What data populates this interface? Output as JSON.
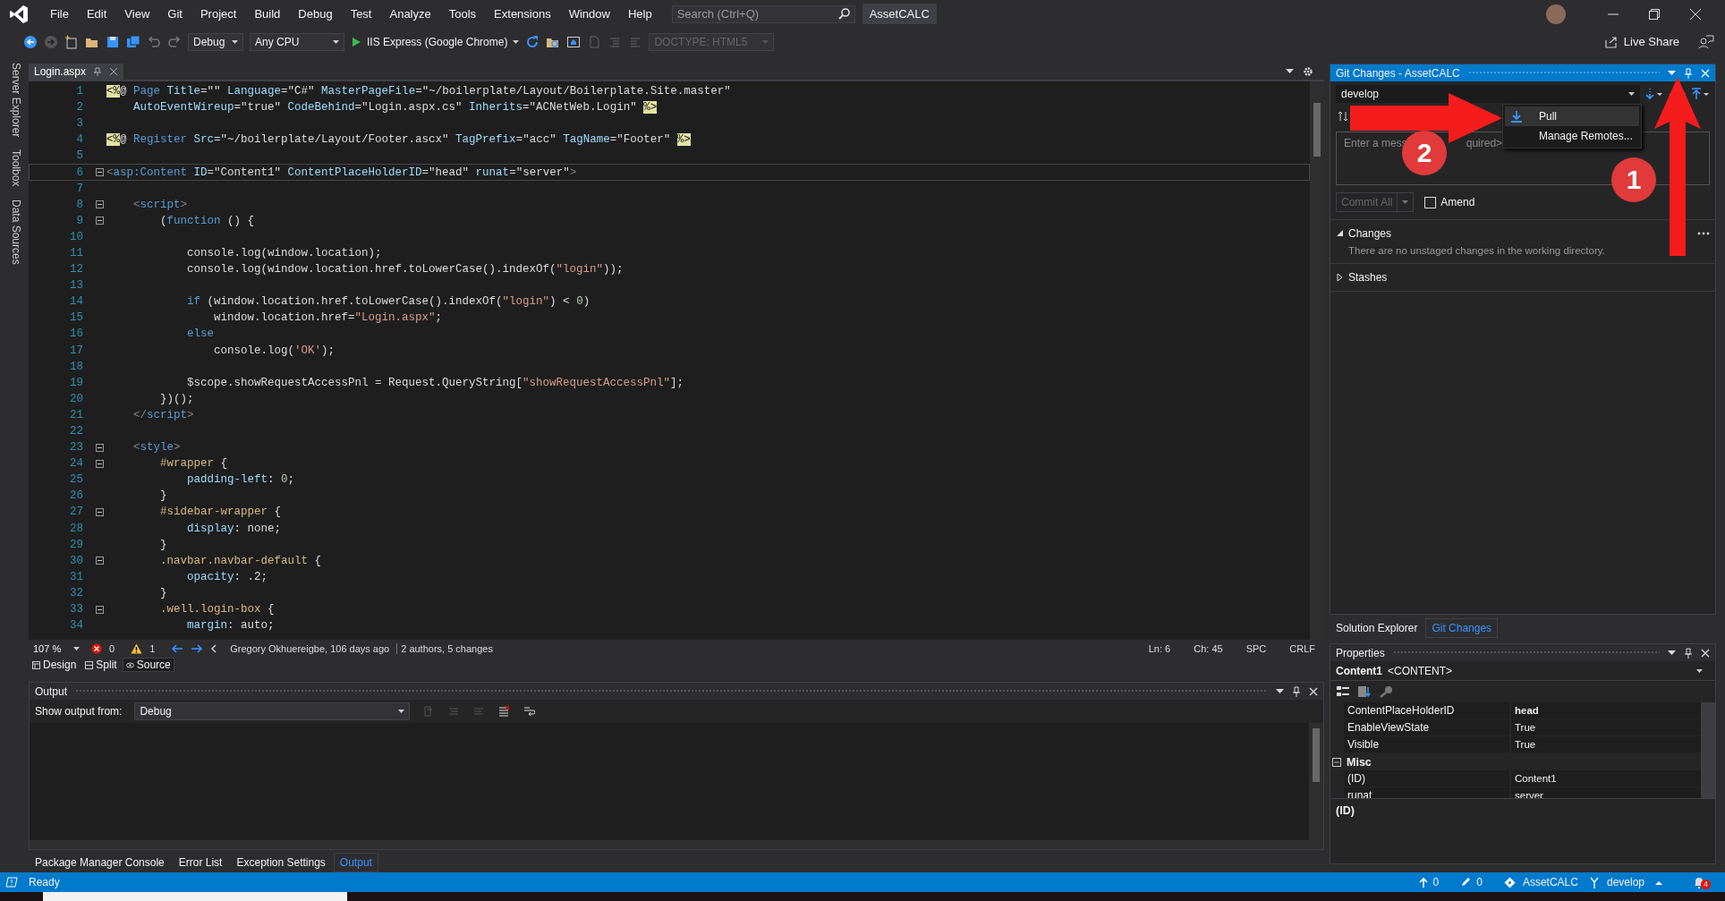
{
  "menu_bar": {
    "items": [
      "File",
      "Edit",
      "View",
      "Git",
      "Project",
      "Build",
      "Debug",
      "Test",
      "Analyze",
      "Tools",
      "Extensions",
      "Window",
      "Help"
    ],
    "search": {
      "placeholder": "Search (Ctrl+Q)"
    },
    "solution_name": "AssetCALC"
  },
  "toolbar": {
    "configuration": "Debug",
    "platform": "Any CPU",
    "run_target": "IIS Express (Google Chrome)",
    "doctype": {
      "value": "DOCTYPE: HTML5",
      "disabled": true
    },
    "live_share": "Live Share"
  },
  "side_tabs": [
    "Server Explorer",
    "Toolbox",
    "Data Sources"
  ],
  "editor": {
    "tabs": [
      {
        "label": "Login.aspx",
        "selected": true
      }
    ],
    "lines": [
      {
        "num": "1",
        "fold": false,
        "current": false,
        "tokens": [
          {
            "kind": "dir",
            "text": "<%"
          },
          {
            "kind": "plain",
            "text": "@ "
          },
          {
            "kind": "kw",
            "text": "Page "
          },
          {
            "kind": "attr",
            "text": "Title"
          },
          {
            "kind": "plain",
            "text": "=\"\" "
          },
          {
            "kind": "attr",
            "text": "Language"
          },
          {
            "kind": "plain",
            "text": "=\"C#\" "
          },
          {
            "kind": "attr",
            "text": "MasterPageFile"
          },
          {
            "kind": "plain",
            "text": "=\"~/boilerplate/Layout/Boilerplate.Site.master\""
          }
        ]
      },
      {
        "num": "2",
        "fold": false,
        "current": false,
        "tokens": [
          {
            "kind": "attr",
            "text": "    AutoEventWireup"
          },
          {
            "kind": "plain",
            "text": "=\"true\" "
          },
          {
            "kind": "attr",
            "text": "CodeBehind"
          },
          {
            "kind": "plain",
            "text": "=\"Login.aspx.cs\" "
          },
          {
            "kind": "attr",
            "text": "Inherits"
          },
          {
            "kind": "plain",
            "text": "=\"ACNetWeb.Login\" "
          },
          {
            "kind": "dir",
            "text": "%>"
          }
        ]
      },
      {
        "num": "3",
        "fold": false,
        "current": false
      },
      {
        "num": "4",
        "fold": false,
        "current": false,
        "tokens": [
          {
            "kind": "dir",
            "text": "<%"
          },
          {
            "kind": "plain",
            "text": "@ "
          },
          {
            "kind": "kw",
            "text": "Register "
          },
          {
            "kind": "attr",
            "text": "Src"
          },
          {
            "kind": "plain",
            "text": "=\"~/boilerplate/Layout/Footer.ascx\" "
          },
          {
            "kind": "attr",
            "text": "TagPrefix"
          },
          {
            "kind": "plain",
            "text": "=\"acc\" "
          },
          {
            "kind": "attr",
            "text": "TagName"
          },
          {
            "kind": "plain",
            "text": "=\"Footer\" "
          },
          {
            "kind": "dir",
            "text": "%>"
          }
        ]
      },
      {
        "num": "5",
        "fold": false,
        "current": false
      },
      {
        "num": "6",
        "fold": true,
        "current": true,
        "tokens": [
          {
            "kind": "punct",
            "text": "<"
          },
          {
            "kind": "kw",
            "text": "asp:Content "
          },
          {
            "kind": "attr",
            "text": "ID"
          },
          {
            "kind": "plain",
            "text": "=\"Content1\" "
          },
          {
            "kind": "attr",
            "text": "ContentPlaceHolderID"
          },
          {
            "kind": "plain",
            "text": "=\"head\" "
          },
          {
            "kind": "attr",
            "text": "runat"
          },
          {
            "kind": "plain",
            "text": "=\"server\""
          },
          {
            "kind": "punct",
            "text": ">"
          }
        ]
      },
      {
        "num": "7",
        "fold": false,
        "current": false
      },
      {
        "num": "8",
        "fold": true,
        "current": false,
        "tokens": [
          {
            "kind": "punct",
            "text": "    <"
          },
          {
            "kind": "kw",
            "text": "script"
          },
          {
            "kind": "punct",
            "text": ">"
          }
        ]
      },
      {
        "num": "9",
        "fold": true,
        "current": false,
        "tokens": [
          {
            "kind": "plain",
            "text": "        ("
          },
          {
            "kind": "kw",
            "text": "function"
          },
          {
            "kind": "plain",
            "text": " () {"
          }
        ]
      },
      {
        "num": "10",
        "fold": false,
        "current": false
      },
      {
        "num": "11",
        "fold": false,
        "current": false,
        "tokens": [
          {
            "kind": "plain",
            "text": "            console.log(window.location);"
          }
        ]
      },
      {
        "num": "12",
        "fold": false,
        "current": false,
        "tokens": [
          {
            "kind": "plain",
            "text": "            console.log(window.location.href.toLowerCase().indexOf("
          },
          {
            "kind": "str",
            "text": "\"login\""
          },
          {
            "kind": "plain",
            "text": "));"
          }
        ]
      },
      {
        "num": "13",
        "fold": false,
        "current": false
      },
      {
        "num": "14",
        "fold": false,
        "current": false,
        "tokens": [
          {
            "kind": "kw",
            "text": "            if"
          },
          {
            "kind": "plain",
            "text": " (window.location.href.toLowerCase().indexOf("
          },
          {
            "kind": "str",
            "text": "\"login\""
          },
          {
            "kind": "plain",
            "text": ") < "
          },
          {
            "kind": "num",
            "text": "0"
          },
          {
            "kind": "plain",
            "text": ")"
          }
        ]
      },
      {
        "num": "15",
        "fold": false,
        "current": false,
        "tokens": [
          {
            "kind": "plain",
            "text": "                window.location.href="
          },
          {
            "kind": "str",
            "text": "\"Login.aspx\""
          },
          {
            "kind": "plain",
            "text": ";"
          }
        ]
      },
      {
        "num": "16",
        "fold": false,
        "current": false,
        "tokens": [
          {
            "kind": "kw",
            "text": "            else"
          }
        ]
      },
      {
        "num": "17",
        "fold": false,
        "current": false,
        "tokens": [
          {
            "kind": "plain",
            "text": "                console.log("
          },
          {
            "kind": "str",
            "text": "'OK'"
          },
          {
            "kind": "plain",
            "text": ");"
          }
        ]
      },
      {
        "num": "18",
        "fold": false,
        "current": false
      },
      {
        "num": "19",
        "fold": false,
        "current": false,
        "tokens": [
          {
            "kind": "plain",
            "text": "            $scope.showRequestAccessPnl = Request.QueryString["
          },
          {
            "kind": "str",
            "text": "\"showRequestAccessPnl\""
          },
          {
            "kind": "plain",
            "text": "];"
          }
        ]
      },
      {
        "num": "20",
        "fold": false,
        "current": false,
        "tokens": [
          {
            "kind": "plain",
            "text": "        })();"
          }
        ]
      },
      {
        "num": "21",
        "fold": false,
        "current": false,
        "tokens": [
          {
            "kind": "punct",
            "text": "    </"
          },
          {
            "kind": "kw",
            "text": "script"
          },
          {
            "kind": "punct",
            "text": ">"
          }
        ]
      },
      {
        "num": "22",
        "fold": false,
        "current": false
      },
      {
        "num": "23",
        "fold": true,
        "current": false,
        "tokens": [
          {
            "kind": "punct",
            "text": "    <"
          },
          {
            "kind": "kw",
            "text": "style"
          },
          {
            "kind": "punct",
            "text": ">"
          }
        ]
      },
      {
        "num": "24",
        "fold": true,
        "current": false,
        "tokens": [
          {
            "kind": "sel",
            "text": "        #wrapper"
          },
          {
            "kind": "plain",
            "text": " {"
          }
        ]
      },
      {
        "num": "25",
        "fold": false,
        "current": false,
        "tokens": [
          {
            "kind": "attr",
            "text": "            padding-left"
          },
          {
            "kind": "plain",
            "text": ": "
          },
          {
            "kind": "num",
            "text": "0"
          },
          {
            "kind": "plain",
            "text": ";"
          }
        ]
      },
      {
        "num": "26",
        "fold": false,
        "current": false,
        "tokens": [
          {
            "kind": "plain",
            "text": "        }"
          }
        ]
      },
      {
        "num": "27",
        "fold": true,
        "current": false,
        "tokens": [
          {
            "kind": "sel",
            "text": "        #sidebar-wrapper"
          },
          {
            "kind": "plain",
            "text": " {"
          }
        ]
      },
      {
        "num": "28",
        "fold": false,
        "current": false,
        "tokens": [
          {
            "kind": "attr",
            "text": "            display"
          },
          {
            "kind": "plain",
            "text": ": none;"
          }
        ]
      },
      {
        "num": "29",
        "fold": false,
        "current": false,
        "tokens": [
          {
            "kind": "plain",
            "text": "        }"
          }
        ]
      },
      {
        "num": "30",
        "fold": true,
        "current": false,
        "tokens": [
          {
            "kind": "sel",
            "text": "        .navbar.navbar-default"
          },
          {
            "kind": "plain",
            "text": " {"
          }
        ]
      },
      {
        "num": "31",
        "fold": false,
        "current": false,
        "tokens": [
          {
            "kind": "attr",
            "text": "            opacity"
          },
          {
            "kind": "plain",
            "text": ": .2;"
          }
        ]
      },
      {
        "num": "32",
        "fold": false,
        "current": false,
        "tokens": [
          {
            "kind": "plain",
            "text": "        }"
          }
        ]
      },
      {
        "num": "33",
        "fold": true,
        "current": false,
        "tokens": [
          {
            "kind": "sel",
            "text": "        .well.login-box"
          },
          {
            "kind": "plain",
            "text": " {"
          }
        ]
      },
      {
        "num": "34",
        "fold": false,
        "current": false,
        "tokens": [
          {
            "kind": "attr",
            "text": "            margin"
          },
          {
            "kind": "plain",
            "text": ": auto;"
          }
        ]
      }
    ],
    "status": {
      "zoom": "107 %",
      "errors": "0",
      "warnings": "1",
      "blame": "Gregory Okhuereigbe, 106 days ago",
      "authors": "2 authors, 5 changes",
      "line": "Ln: 6",
      "column": "Ch: 45",
      "whitespace": "SPC",
      "line_ending": "CRLF"
    },
    "views": [
      {
        "label": "Design",
        "selected": false
      },
      {
        "label": "Split",
        "selected": false
      },
      {
        "label": "Source",
        "selected": true
      }
    ]
  },
  "output": {
    "title": "Output",
    "source_label": "Show output from:",
    "source": "Debug"
  },
  "bottom_tabs": [
    {
      "label": "Package Manager Console",
      "selected": false
    },
    {
      "label": "Error List",
      "selected": false
    },
    {
      "label": "Exception Settings",
      "selected": false
    },
    {
      "label": "Output",
      "selected": true
    }
  ],
  "git_changes": {
    "title": "Git Changes - AssetCALC",
    "branch": "develop",
    "message": {
      "placeholder": [
        "Enter a mess",
        "quired>"
      ]
    },
    "commit_button": {
      "label": "Commit All",
      "disabled": true
    },
    "amend": {
      "label": "Amend",
      "checked": false
    },
    "sections": [
      {
        "title": "Changes",
        "expanded": true,
        "text": "There are no unstaged changes in the working directory."
      },
      {
        "title": "Stashes",
        "expanded": false
      }
    ],
    "menu": [
      {
        "label": "Pull",
        "selected": true
      },
      {
        "label": "Manage Remotes...",
        "selected": false
      }
    ],
    "callouts": [
      {
        "text": "1"
      },
      {
        "text": "2"
      }
    ]
  },
  "right_tabs": [
    {
      "label": "Solution Explorer",
      "selected": false
    },
    {
      "label": "Git Changes",
      "selected": true
    }
  ],
  "properties": {
    "title": "Properties",
    "object": "Content1",
    "object_type": "<CONTENT>",
    "rows": [
      {
        "kind": "property",
        "name": "ContentPlaceHolderID",
        "value": "head",
        "bold": true
      },
      {
        "kind": "property",
        "name": "EnableViewState",
        "value": "True",
        "bold": false
      },
      {
        "kind": "property",
        "name": "Visible",
        "value": "True",
        "bold": false
      },
      {
        "kind": "category",
        "name": "Misc",
        "expanded": true
      },
      {
        "kind": "property",
        "name": "(ID)",
        "value": "Content1",
        "bold": false
      },
      {
        "kind": "property",
        "name": "runat",
        "value": "server",
        "bold": false
      }
    ],
    "description": "(ID)"
  },
  "status_bar": {
    "text": "Ready",
    "pushes": "0",
    "edits": "0",
    "repo": "AssetCALC",
    "branch": "develop",
    "notifications": "4"
  }
}
